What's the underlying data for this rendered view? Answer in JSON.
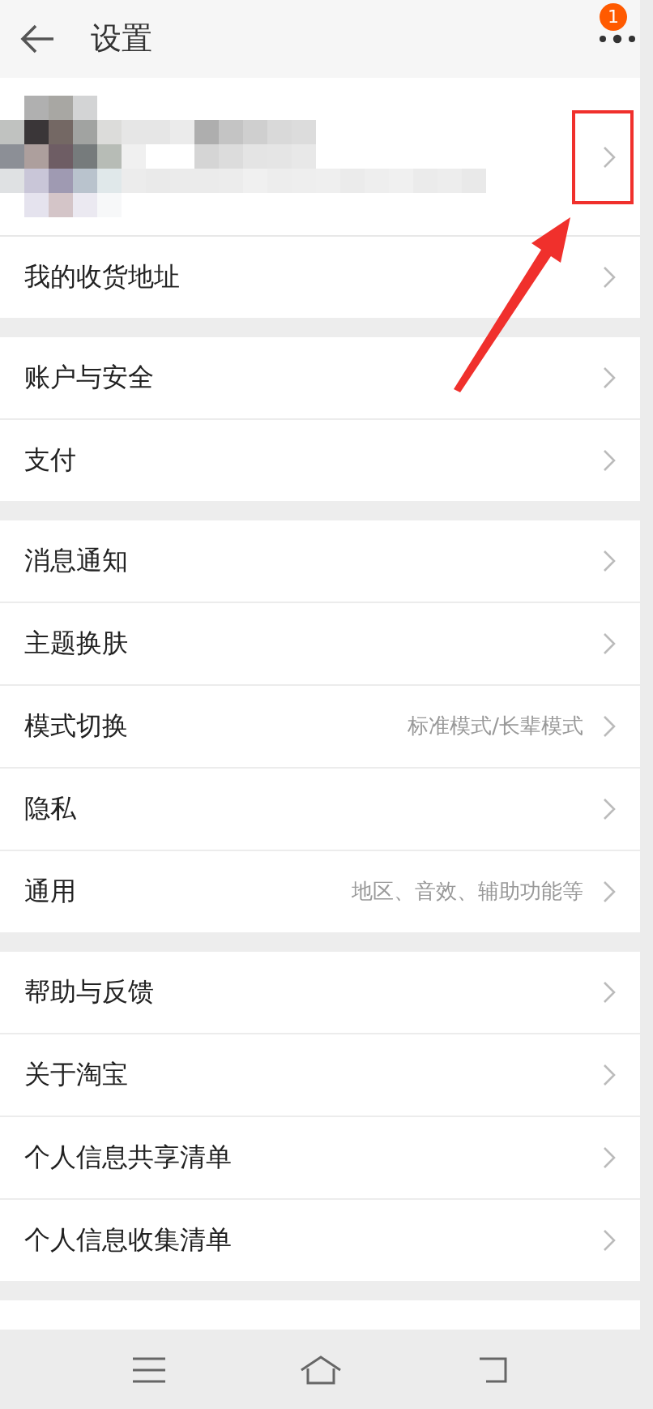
{
  "header": {
    "title": "设置",
    "badge": "1"
  },
  "groups": [
    {
      "items": [
        {
          "label": "我的收货地址"
        }
      ]
    },
    {
      "items": [
        {
          "label": "账户与安全"
        },
        {
          "label": "支付"
        }
      ]
    },
    {
      "items": [
        {
          "label": "消息通知"
        },
        {
          "label": "主题换肤"
        },
        {
          "label": "模式切换",
          "value": "标准模式/长辈模式"
        },
        {
          "label": "隐私"
        },
        {
          "label": "通用",
          "value": "地区、音效、辅助功能等"
        }
      ]
    },
    {
      "items": [
        {
          "label": "帮助与反馈"
        },
        {
          "label": "关于淘宝"
        },
        {
          "label": "个人信息共享清单"
        },
        {
          "label": "个人信息收集清单"
        }
      ]
    }
  ]
}
